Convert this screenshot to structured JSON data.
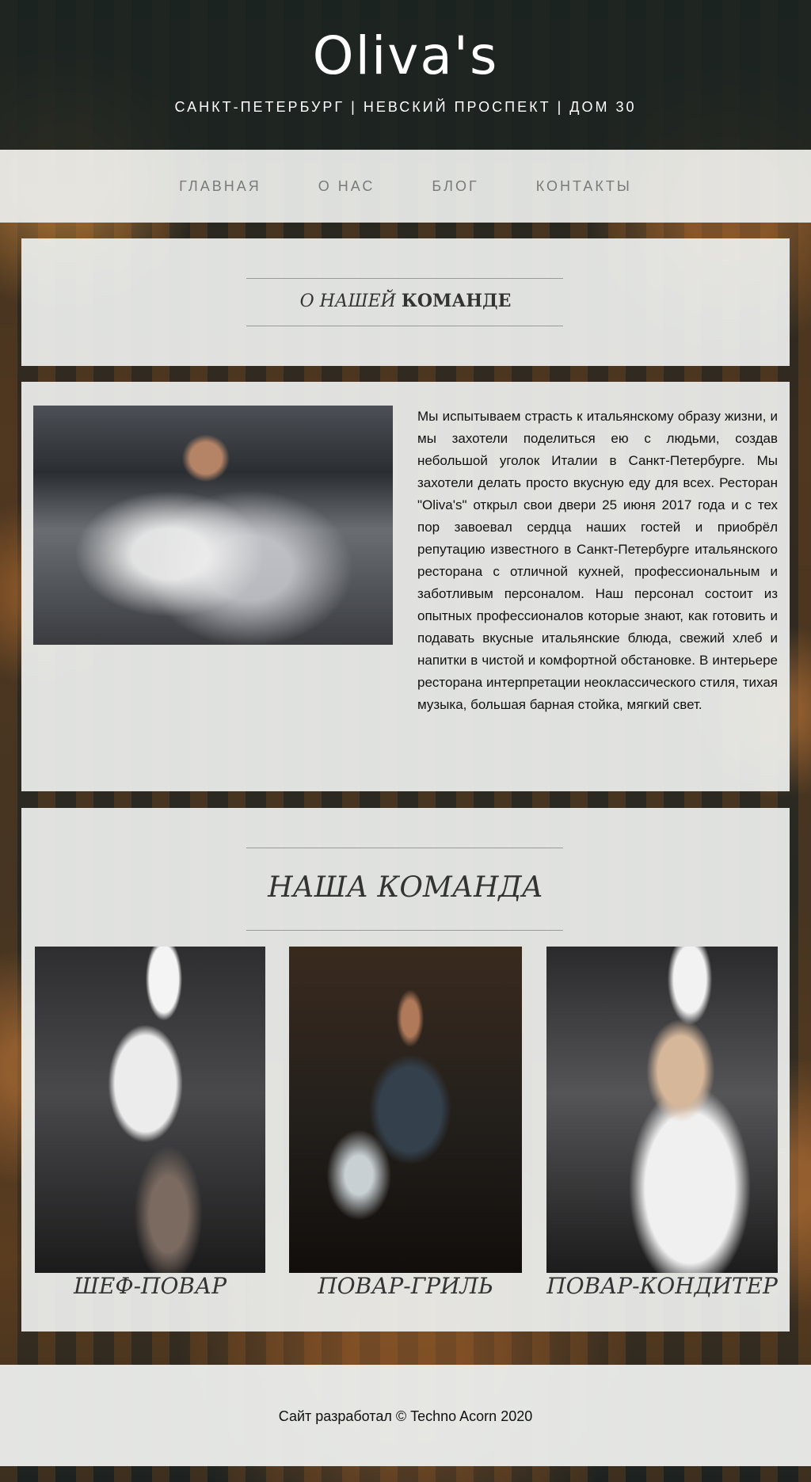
{
  "header": {
    "logo": "Oliva's",
    "address": "САНКТ-ПЕТЕРБУРГ | НЕВСКИЙ ПРОСПЕКТ | ДОМ 30"
  },
  "nav": {
    "items": [
      {
        "label": "ГЛАВНАЯ"
      },
      {
        "label": "О НАС"
      },
      {
        "label": "БЛОГ"
      },
      {
        "label": "КОНТАКТЫ"
      }
    ]
  },
  "about_heading": {
    "prefix": "О НАШЕЙ",
    "bold": "КОМАНДЕ"
  },
  "about": {
    "text": "Мы испытываем страсть к итальянскому образу жизни, и мы захотели поделиться ею с людьми, создав небольшой уголок Италии в Санкт-Петербурге. Мы захотели делать просто вкусную еду для всех. Ресторан \"Oliva's\" открыл свои двери 25 июня 2017 года и с тех пор завоевал сердца наших гостей и приобрёл репутацию известного в Санкт-Петербурге итальянского ресторана с отличной кухней, профессиональным и заботливым персоналом. Наш персонал состоит из опытных профессионалов которые знают, как готовить и подавать вкусные итальянские блюда, свежий хлеб и напитки в чистой и комфортной обстановке. В интерьере ресторана интерпретации неоклассического стиля, тихая музыка, большая барная стойка, мягкий свет."
  },
  "team": {
    "title": "НАША КОМАНДА",
    "members": [
      {
        "role": "ШЕФ-ПОВАР"
      },
      {
        "role": "ПОВАР-ГРИЛЬ"
      },
      {
        "role": "ПОВАР-КОНДИТЕР"
      }
    ]
  },
  "footer": {
    "text": "Сайт разработал © Techno Acorn 2020"
  },
  "colors": {
    "header_bg": "#1c2421",
    "panel_bg": "#ebedeb",
    "nav_text": "#7a7a7a"
  }
}
